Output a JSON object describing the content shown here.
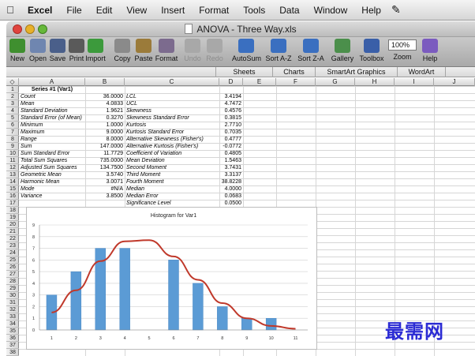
{
  "menubar": {
    "apple": "",
    "items": [
      "Excel",
      "File",
      "Edit",
      "View",
      "Insert",
      "Format",
      "Tools",
      "Data",
      "Window",
      "Help"
    ],
    "script_icon": "✎"
  },
  "window": {
    "title": "ANOVA - Three Way.xls"
  },
  "toolbar": {
    "buttons": [
      {
        "label": "New",
        "icon": "new-doc-icon",
        "color": "#3f8f2f"
      },
      {
        "label": "Open",
        "icon": "open-folder-icon",
        "color": "#6f86b0"
      },
      {
        "label": "Save",
        "icon": "save-icon",
        "color": "#4a5f8a"
      },
      {
        "label": "Print",
        "icon": "print-icon",
        "color": "#5a5a5a"
      },
      {
        "label": "Import",
        "icon": "import-icon",
        "color": "#3c9a3c"
      },
      {
        "label": "Copy",
        "icon": "copy-icon",
        "color": "#8a8a8a"
      },
      {
        "label": "Paste",
        "icon": "paste-icon",
        "color": "#9b7b3a"
      },
      {
        "label": "Format",
        "icon": "format-brush-icon",
        "color": "#7c6b8e"
      },
      {
        "label": "Undo",
        "icon": "undo-icon",
        "color": "#a8a8a8",
        "disabled": true
      },
      {
        "label": "Redo",
        "icon": "redo-icon",
        "color": "#a8a8a8",
        "disabled": true
      },
      {
        "label": "AutoSum",
        "icon": "sigma-icon",
        "color": "#3a6fc0"
      },
      {
        "label": "Sort A-Z",
        "icon": "sort-az-icon",
        "color": "#3a6fc0"
      },
      {
        "label": "Sort Z-A",
        "icon": "sort-za-icon",
        "color": "#3a6fc0"
      },
      {
        "label": "Gallery",
        "icon": "gallery-icon",
        "color": "#4b8f4b"
      },
      {
        "label": "Toolbox",
        "icon": "toolbox-icon",
        "color": "#3a5fa8"
      },
      {
        "label": "Zoom",
        "icon": "zoom-icon",
        "value": "100%"
      },
      {
        "label": "Help",
        "icon": "help-icon",
        "color": "#7b5bbf"
      }
    ]
  },
  "ribbon": {
    "tabs": [
      "Sheets",
      "Charts",
      "SmartArt Graphics",
      "WordArt"
    ]
  },
  "columns": [
    "A",
    "B",
    "C",
    "D",
    "E",
    "F",
    "G",
    "H",
    "I",
    "J"
  ],
  "rows": [
    "1",
    "2",
    "3",
    "4",
    "5",
    "6",
    "7",
    "8",
    "9",
    "10",
    "11",
    "12",
    "13",
    "14",
    "15",
    "16",
    "17",
    "18",
    "19",
    "20",
    "21",
    "22",
    "23",
    "24",
    "25",
    "26",
    "27",
    "28",
    "29",
    "30",
    "31",
    "32",
    "33",
    "34",
    "35",
    "36",
    "37",
    "38"
  ],
  "sheet": {
    "header": "Series #1 (Var1)",
    "left": [
      {
        "label": "Count",
        "value": "36.0000"
      },
      {
        "label": "Mean",
        "value": "4.0833"
      },
      {
        "label": "Standard Deviation",
        "value": "1.9621"
      },
      {
        "label": "Standard Error (of Mean)",
        "value": "0.3270"
      },
      {
        "label": "Minimum",
        "value": "1.0000"
      },
      {
        "label": "Maximum",
        "value": "9.0000"
      },
      {
        "label": "Range",
        "value": "8.0000"
      },
      {
        "label": "Sum",
        "value": "147.0000"
      },
      {
        "label": "Sum Standard Error",
        "value": "11.7729"
      },
      {
        "label": "Total Sum Squares",
        "value": "735.0000"
      },
      {
        "label": "Adjusted Sum Squares",
        "value": "134.7500"
      },
      {
        "label": "Geometric Mean",
        "value": "3.5740"
      },
      {
        "label": "Harmonic Mean",
        "value": "3.0071"
      },
      {
        "label": "Mode",
        "value": "#N/A"
      },
      {
        "label": "Variance",
        "value": "3.8500"
      }
    ],
    "right": [
      {
        "label": "LCL",
        "value": "3.4194"
      },
      {
        "label": "UCL",
        "value": "4.7472"
      },
      {
        "label": "Skewness",
        "value": "0.4576"
      },
      {
        "label": "Skewness Standard Error",
        "value": "0.3815"
      },
      {
        "label": "Kurtosis",
        "value": "2.7710"
      },
      {
        "label": "Kurtosis Standard Error",
        "value": "0.7035"
      },
      {
        "label": "Alternative Skewness (Fisher's)",
        "value": "0.4777"
      },
      {
        "label": "Alternative Kurtosis (Fisher's)",
        "value": "-0.0772"
      },
      {
        "label": "Coefficient of Variation",
        "value": "0.4805"
      },
      {
        "label": "Mean Deviation",
        "value": "1.5463"
      },
      {
        "label": "Second Moment",
        "value": "3.7431"
      },
      {
        "label": "Third Moment",
        "value": "3.3137"
      },
      {
        "label": "Fourth Moment",
        "value": "38.8228"
      },
      {
        "label": "Median",
        "value": "4.0000"
      },
      {
        "label": "Median Error",
        "value": "0.0683"
      },
      {
        "label": "Significance Level",
        "value": "0.0500"
      }
    ]
  },
  "chart_data": {
    "type": "bar",
    "title": "Histogram for Var1",
    "categories": [
      "1",
      "2",
      "3",
      "4",
      "5",
      "6",
      "7",
      "8",
      "9",
      "10",
      "11"
    ],
    "series": [
      {
        "values": [
          3,
          5,
          7,
          7,
          0,
          6,
          4,
          2,
          1,
          1,
          0
        ]
      }
    ],
    "curve": {
      "x": [
        1,
        2,
        3,
        4,
        5,
        6,
        7,
        8,
        9,
        10,
        11
      ],
      "y": [
        1.5,
        3.4,
        5.9,
        7.6,
        7.7,
        6.3,
        4.3,
        2.3,
        1.0,
        0.35,
        0.1
      ]
    },
    "ylim": [
      0,
      9
    ],
    "yticks": [
      "0",
      "1",
      "2",
      "3",
      "4",
      "5",
      "6",
      "7",
      "8",
      "9"
    ],
    "bar_color": "#5b9bd5",
    "curve_color": "#c0392b",
    "grid": true
  },
  "watermark": "最需网"
}
